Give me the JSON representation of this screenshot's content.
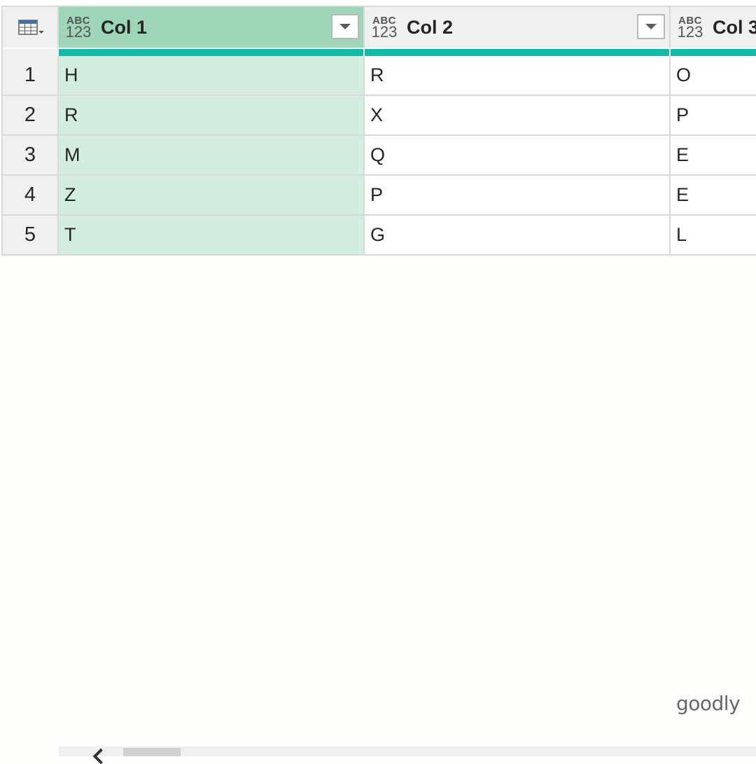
{
  "grid": {
    "columns": [
      {
        "name": "Col 1",
        "type_abc": "ABC",
        "type_num": "123",
        "selected": true
      },
      {
        "name": "Col 2",
        "type_abc": "ABC",
        "type_num": "123",
        "selected": false
      },
      {
        "name": "Col 3",
        "type_abc": "ABC",
        "type_num": "123",
        "selected": false
      }
    ],
    "rows": [
      {
        "num": "1",
        "cells": [
          "H",
          "R",
          "O"
        ]
      },
      {
        "num": "2",
        "cells": [
          "R",
          "X",
          "P"
        ]
      },
      {
        "num": "3",
        "cells": [
          "M",
          "Q",
          "E"
        ]
      },
      {
        "num": "4",
        "cells": [
          "Z",
          "P",
          "E"
        ]
      },
      {
        "num": "5",
        "cells": [
          "T",
          "G",
          "L"
        ]
      }
    ]
  },
  "watermark": "goodly",
  "colors": {
    "selected_header": "#9fd5b8",
    "selected_cell": "#d3eee0",
    "quality_bar": "#0dbba6"
  },
  "icons": {
    "table_menu": "table-icon",
    "type": "abc-123-icon",
    "dropdown": "chevron-down-icon",
    "scroll_left": "arrow-left-icon"
  }
}
